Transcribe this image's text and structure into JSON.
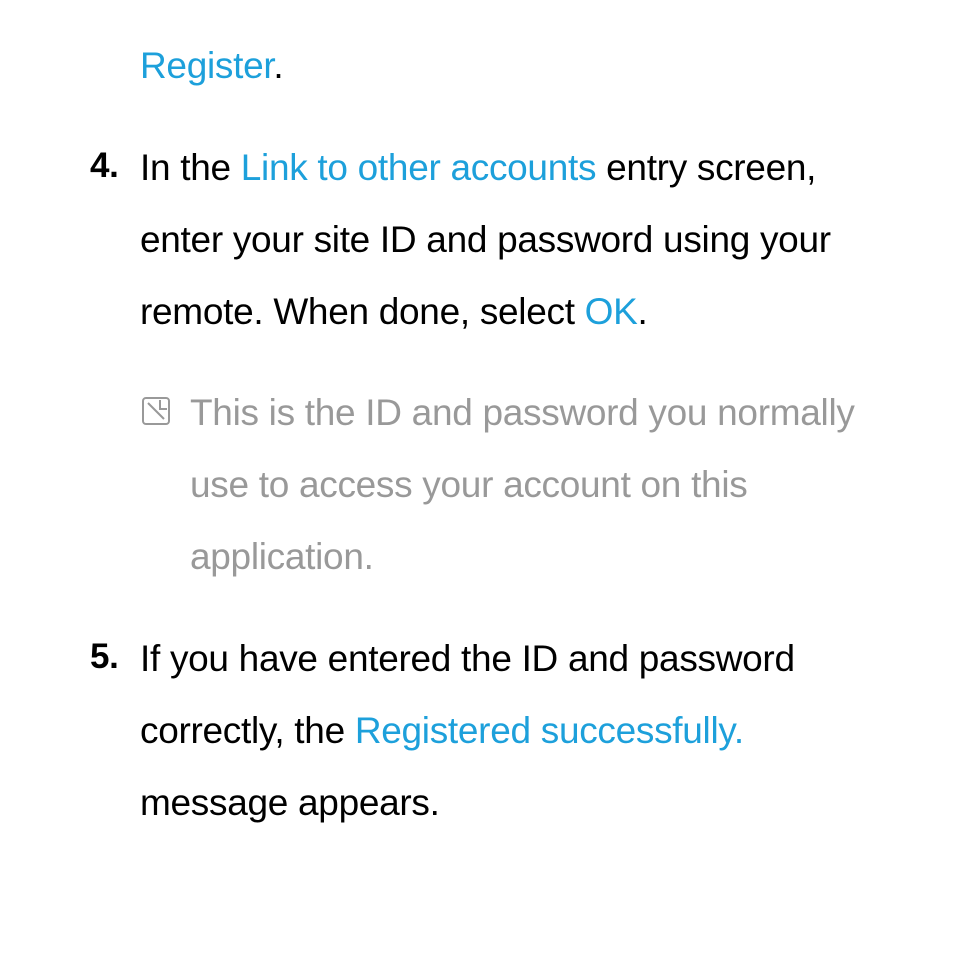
{
  "register": {
    "label": "Register"
  },
  "step4": {
    "number": "4.",
    "prefix": "In the ",
    "link1": "Link to other accounts",
    "mid": " entry screen, enter your site ID and password using your remote. When done, select ",
    "link2": "OK",
    "suffix": "."
  },
  "note": {
    "text": "This is the ID and password you normally use to access your account on this application."
  },
  "step5": {
    "number": "5.",
    "prefix": "If you have entered the ID and password correctly, the ",
    "link1": "Registered successfully.",
    "suffix": " message appears."
  }
}
